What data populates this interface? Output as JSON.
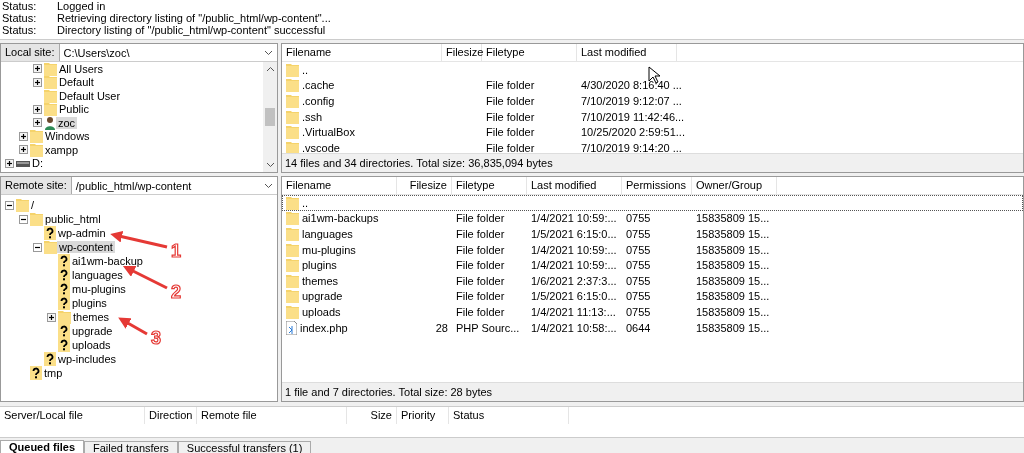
{
  "log": [
    {
      "label": "Status:",
      "message": "Logged in"
    },
    {
      "label": "Status:",
      "message": "Retrieving directory listing of \"/public_html/wp-content\"..."
    },
    {
      "label": "Status:",
      "message": "Directory listing of \"/public_html/wp-content\" successful"
    }
  ],
  "local": {
    "site_label": "Local site:",
    "path": "C:\\Users\\zoc\\",
    "tree": [
      {
        "children": [
          {
            "children": [
              {
                "label": "All Users",
                "expanded": false,
                "kind": "folder",
                "selected": false
              },
              {
                "label": "Default",
                "expanded": false,
                "kind": "folder",
                "selected": false
              },
              {
                "label": "Default User",
                "kind": "folder",
                "selected": false
              },
              {
                "label": "Public",
                "expanded": false,
                "kind": "folder",
                "selected": false
              },
              {
                "label": "zoc",
                "expanded": false,
                "kind": "user",
                "selected": true
              }
            ]
          },
          {
            "label": "Windows",
            "expanded": false,
            "kind": "folder",
            "selected": false
          },
          {
            "label": "xampp",
            "expanded": false,
            "kind": "folder",
            "selected": false
          }
        ]
      },
      {
        "label": "D:",
        "expanded": false,
        "kind": "drive",
        "selected": false
      }
    ],
    "columns": [
      "Filename",
      "Filesize",
      "Filetype",
      "Last modified"
    ],
    "rows": [
      {
        "kind": "folder",
        "focused": false,
        "cells": [
          "..",
          "",
          "",
          ""
        ]
      },
      {
        "kind": "folder",
        "focused": false,
        "cells": [
          ".cache",
          "",
          "File folder",
          "4/30/2020 8:16:40 ..."
        ]
      },
      {
        "kind": "folder",
        "focused": false,
        "cells": [
          ".config",
          "",
          "File folder",
          "7/10/2019 9:12:07 ..."
        ]
      },
      {
        "kind": "folder",
        "focused": false,
        "cells": [
          ".ssh",
          "",
          "File folder",
          "7/10/2019 11:42:46..."
        ]
      },
      {
        "kind": "folder",
        "focused": false,
        "cells": [
          ".VirtualBox",
          "",
          "File folder",
          "10/25/2020 2:59:51..."
        ]
      },
      {
        "kind": "folder",
        "focused": false,
        "cells": [
          ".vscode",
          "",
          "File folder",
          "7/10/2019 9:14:20 ..."
        ]
      }
    ],
    "summary": "14 files and 34 directories. Total size: 36,835,094 bytes"
  },
  "remote": {
    "site_label": "Remote site:",
    "path": "/public_html/wp-content",
    "tree": [
      {
        "label": "/",
        "expanded": true,
        "kind": "folder",
        "selected": false,
        "children": [
          {
            "label": "public_html",
            "expanded": true,
            "kind": "folder",
            "selected": false,
            "children": [
              {
                "label": "wp-admin",
                "kind": "unknown",
                "selected": false
              },
              {
                "label": "wp-content",
                "expanded": true,
                "kind": "folder",
                "selected": true,
                "children": [
                  {
                    "label": "ai1wm-backup",
                    "kind": "unknown",
                    "selected": false
                  },
                  {
                    "label": "languages",
                    "kind": "unknown",
                    "selected": false
                  },
                  {
                    "label": "mu-plugins",
                    "kind": "unknown",
                    "selected": false
                  },
                  {
                    "label": "plugins",
                    "kind": "unknown",
                    "selected": false
                  },
                  {
                    "label": "themes",
                    "expanded": false,
                    "kind": "folder",
                    "selected": false
                  },
                  {
                    "label": "upgrade",
                    "kind": "unknown",
                    "selected": false
                  },
                  {
                    "label": "uploads",
                    "kind": "unknown",
                    "selected": false
                  }
                ]
              },
              {
                "label": "wp-includes",
                "kind": "unknown",
                "selected": false
              }
            ]
          },
          {
            "label": "tmp",
            "kind": "unknown",
            "selected": false
          }
        ]
      }
    ],
    "annotations": [
      "1",
      "2",
      "3"
    ],
    "columns": [
      "Filename",
      "Filesize",
      "Filetype",
      "Last modified",
      "Permissions",
      "Owner/Group"
    ],
    "rows": [
      {
        "kind": "folder",
        "focused": true,
        "cells": [
          "..",
          "",
          "",
          "",
          "",
          ""
        ]
      },
      {
        "kind": "folder",
        "focused": false,
        "cells": [
          "ai1wm-backups",
          "",
          "File folder",
          "1/4/2021 10:59:...",
          "0755",
          "15835809 15..."
        ]
      },
      {
        "kind": "folder",
        "focused": false,
        "cells": [
          "languages",
          "",
          "File folder",
          "1/5/2021 6:15:0...",
          "0755",
          "15835809 15..."
        ]
      },
      {
        "kind": "folder",
        "focused": false,
        "cells": [
          "mu-plugins",
          "",
          "File folder",
          "1/4/2021 10:59:...",
          "0755",
          "15835809 15..."
        ]
      },
      {
        "kind": "folder",
        "focused": false,
        "cells": [
          "plugins",
          "",
          "File folder",
          "1/4/2021 10:59:...",
          "0755",
          "15835809 15..."
        ]
      },
      {
        "kind": "folder",
        "focused": false,
        "cells": [
          "themes",
          "",
          "File folder",
          "1/6/2021 2:37:3...",
          "0755",
          "15835809 15..."
        ]
      },
      {
        "kind": "folder",
        "focused": false,
        "cells": [
          "upgrade",
          "",
          "File folder",
          "1/5/2021 6:15:0...",
          "0755",
          "15835809 15..."
        ]
      },
      {
        "kind": "folder",
        "focused": false,
        "cells": [
          "uploads",
          "",
          "File folder",
          "1/4/2021 11:13:...",
          "0755",
          "15835809 15..."
        ]
      },
      {
        "kind": "php",
        "focused": false,
        "cells": [
          "index.php",
          "28",
          "PHP Sourc...",
          "1/4/2021 10:58:...",
          "0644",
          "15835809 15..."
        ]
      }
    ],
    "summary": "1 file and 7 directories. Total size: 28 bytes"
  },
  "queue": {
    "columns": [
      "Server/Local file",
      "Direction",
      "Remote file",
      "Size",
      "Priority",
      "Status"
    ],
    "tabs": [
      {
        "label": "Queued files",
        "selected": true
      },
      {
        "label": "Failed transfers",
        "selected": false
      },
      {
        "label": "Successful transfers (1)",
        "selected": false
      }
    ]
  }
}
